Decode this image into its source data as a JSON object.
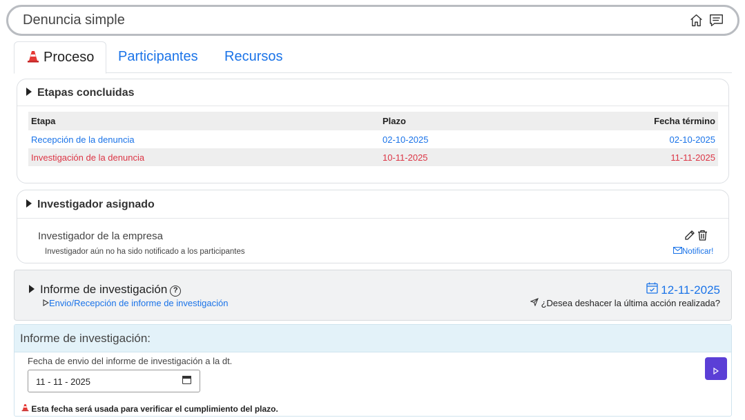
{
  "header": {
    "title": "Denuncia simple",
    "icons": [
      "home-icon",
      "chat-icon"
    ]
  },
  "tabs": [
    {
      "label": "Proceso",
      "active": true,
      "icon": "traffic-cone-icon"
    },
    {
      "label": "Participantes",
      "active": false
    },
    {
      "label": "Recursos",
      "active": false
    }
  ],
  "etapas": {
    "title": "Etapas concluidas",
    "columns": [
      "Etapa",
      "Plazo",
      "Fecha término"
    ],
    "rows": [
      {
        "etapa": "Recepción de la denuncia",
        "plazo": "02-10-2025",
        "fecha": "02-10-2025",
        "status": "on-time"
      },
      {
        "etapa": "Investigación de la denuncia",
        "plazo": "10-11-2025",
        "fecha": "11-11-2025",
        "status": "late"
      }
    ]
  },
  "investigador": {
    "title": "Investigador asignado",
    "name": "Investigador de la empresa",
    "note": "Investigador aún no ha sido notificado a los participantes",
    "notify_label": "Notificar!"
  },
  "informe": {
    "title": "Informe de investigación",
    "help": "?",
    "date": "12-11-2025",
    "link": "Envio/Recepción de informe de investigación",
    "undo": "¿Desea deshacer la última acción realizada?"
  },
  "form": {
    "header": "Informe de investigación:",
    "field_label": "Fecha de envio del informe de investigación a la dt.",
    "date_value": "11 - 11 - 2025",
    "warning": "Esta fecha será usada para verificar el cumplimiento del plazo."
  },
  "colors": {
    "link": "#1a73e8",
    "danger": "#dc3545",
    "primary": "#5b3fd6",
    "info_bg": "#e3f2f9"
  }
}
